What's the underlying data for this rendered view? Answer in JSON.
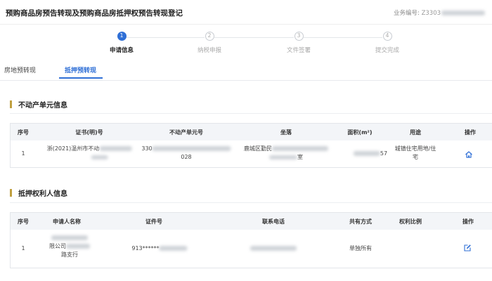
{
  "header": {
    "title": "预购商品房预告转现及预购商品房抵押权预告转现登记",
    "biz_label": "业务编号:",
    "biz_value_prefix": "Z3303"
  },
  "steps": [
    {
      "num": "1",
      "label": "申请信息",
      "active": true
    },
    {
      "num": "2",
      "label": "纳税申报",
      "active": false
    },
    {
      "num": "3",
      "label": "文件签署",
      "active": false
    },
    {
      "num": "4",
      "label": "提交完成",
      "active": false
    }
  ],
  "tabs": [
    {
      "label": "房地预转现",
      "active": false
    },
    {
      "label": "抵押预转现",
      "active": true
    }
  ],
  "property_section": {
    "title": "不动产单元信息",
    "columns": [
      "序号",
      "证书(明)号",
      "不动产单元号",
      "坐落",
      "面积(m²)",
      "用途",
      "操作"
    ],
    "rows": [
      {
        "index": "1",
        "cert_prefix": "浙(2021)温州市不动",
        "unit_prefix": "330",
        "unit_suffix": "028",
        "location_prefix": "鹿城区勤民",
        "location_suffix": "室",
        "area_suffix": "57",
        "usage_line1": "城镇住宅用地/住",
        "usage_line2": "宅",
        "action_icon": "home-icon"
      }
    ]
  },
  "mortgage_section": {
    "title": "抵押权利人信息",
    "columns": [
      "序号",
      "申请人名称",
      "证件号",
      "联系电话",
      "共有方式",
      "权利比例",
      "操作"
    ],
    "rows": [
      {
        "index": "1",
        "name_line2": "限公司",
        "name_line3": "路支行",
        "id_prefix": "913******",
        "share_mode": "单独所有",
        "action_icon": "edit-icon"
      }
    ]
  },
  "colors": {
    "accent": "#2f6fd6",
    "section_marker": "#c0a040",
    "table_header_bg": "#f3f5f8"
  }
}
